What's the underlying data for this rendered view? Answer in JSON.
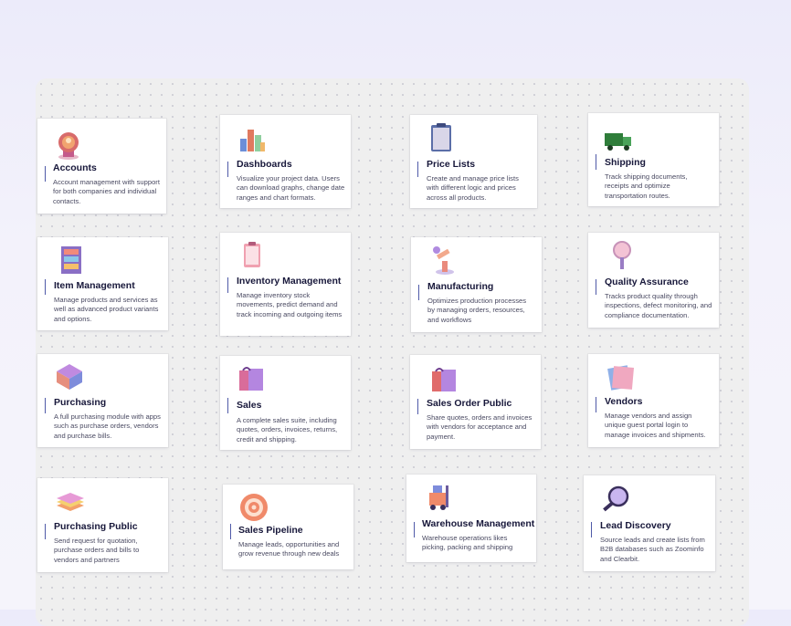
{
  "modules": [
    {
      "title": "Accounts",
      "icon": "medallion-icon",
      "description": "Account management with support for both companies and individual contacts."
    },
    {
      "title": "Dashboards",
      "icon": "bar-chart-blocks-icon",
      "description": "Visualize your project data. Users can download graphs, change date ranges and chart formats."
    },
    {
      "title": "Price Lists",
      "icon": "clipboard-icon",
      "description": "Create and manage price lists with different logic and prices across all products."
    },
    {
      "title": "Shipping",
      "icon": "truck-icon",
      "description": "Track shipping documents, receipts and optimize transportation routes."
    },
    {
      "title": "Item Management",
      "icon": "shelving-icon",
      "description": "Manage products and services as well as advanced product variants and options."
    },
    {
      "title": "Inventory Management",
      "icon": "inventory-clipboard-icon",
      "description": "Manage inventory stock movements, predict demand and track incoming and outgoing items"
    },
    {
      "title": "Manufacturing",
      "icon": "robot-arm-icon",
      "description": "Optimizes production processes by managing orders, resources, and workflows"
    },
    {
      "title": "Quality Assurance",
      "icon": "magnifier-icon",
      "description": "Tracks product quality through inspections, defect monitoring, and compliance documentation."
    },
    {
      "title": "Purchasing",
      "icon": "package-box-icon",
      "description": "A full purchasing module with apps such as purchase orders, vendors and purchase bills."
    },
    {
      "title": "Sales",
      "icon": "shopping-bags-icon",
      "description": "A complete sales suite, including quotes, orders, invoices, returns, credit and shipping."
    },
    {
      "title": "Sales Order Public",
      "icon": "shopping-bags-icon",
      "description": "Share quotes, orders and invoices with vendors for acceptance and payment."
    },
    {
      "title": "Vendors",
      "icon": "stacked-cards-icon",
      "description": "Manage vendors and assign unique guest portal login to manage invoices and shipments."
    },
    {
      "title": "Purchasing Public",
      "icon": "stacked-papers-icon",
      "description": "Send request for quotation, purchase orders and bills to vendors and partners"
    },
    {
      "title": "Sales Pipeline",
      "icon": "target-icon",
      "description": "Manage leads, opportunities and grow revenue through new deals"
    },
    {
      "title": "Warehouse Management",
      "icon": "forklift-icon",
      "description": "Warehouse operations likes picking, packing and shipping"
    },
    {
      "title": "Lead Discovery",
      "icon": "magnifying-glass-icon",
      "description": "Source leads and create lists from B2B databases such as Zoominfo and Clearbit."
    }
  ]
}
